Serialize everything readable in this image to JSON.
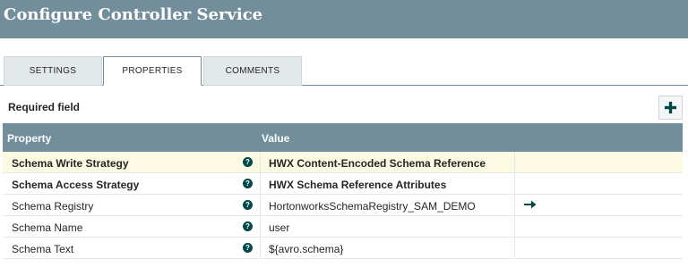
{
  "dialog": {
    "title": "Configure Controller Service"
  },
  "tabs": [
    {
      "label": "SETTINGS",
      "active": false
    },
    {
      "label": "PROPERTIES",
      "active": true
    },
    {
      "label": "COMMENTS",
      "active": false
    }
  ],
  "properties": {
    "required_label": "Required field",
    "add_icon": "plus-icon",
    "columns": {
      "property": "Property",
      "value": "Value"
    },
    "rows": [
      {
        "name": "Schema Write Strategy",
        "value": "HWX Content-Encoded Schema Reference",
        "required": true,
        "highlighted": true
      },
      {
        "name": "Schema Access Strategy",
        "value": "HWX Schema Reference Attributes",
        "required": true
      },
      {
        "name": "Schema Registry",
        "value": "HortonworksSchemaRegistry_SAM_DEMO",
        "required": false,
        "action_icon": "arrow-right-icon"
      },
      {
        "name": "Schema Name",
        "value": "user",
        "required": false
      },
      {
        "name": "Schema Text",
        "value": "${avro.schema}",
        "required": false
      }
    ],
    "help_icon_glyph": "?"
  },
  "colors": {
    "header": "#728e9b",
    "highlight_row": "#fcfae3",
    "help_icon": "#004849"
  }
}
